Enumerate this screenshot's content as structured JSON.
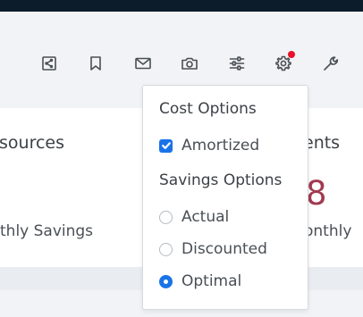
{
  "toolbar": {
    "icons": [
      "share-icon",
      "bookmark-icon",
      "mail-icon",
      "camera-icon",
      "sliders-icon",
      "gear-icon",
      "wrench-icon"
    ],
    "notification_color": "#e8102a"
  },
  "cards": {
    "left": {
      "title": "sources",
      "subtitle": "thly Savings"
    },
    "right": {
      "title": "ents",
      "value": "8",
      "subtitle": "onthly"
    }
  },
  "dropdown": {
    "cost_heading": "Cost Options",
    "cost_options": [
      {
        "label": "Amortized",
        "checked": true
      }
    ],
    "savings_heading": "Savings Options",
    "savings_options": [
      {
        "label": "Actual",
        "selected": false
      },
      {
        "label": "Discounted",
        "selected": false
      },
      {
        "label": "Optimal",
        "selected": true
      }
    ]
  },
  "colors": {
    "accent": "#1a73e8",
    "value": "#a23a52",
    "header_bar": "#0d1c2b"
  }
}
